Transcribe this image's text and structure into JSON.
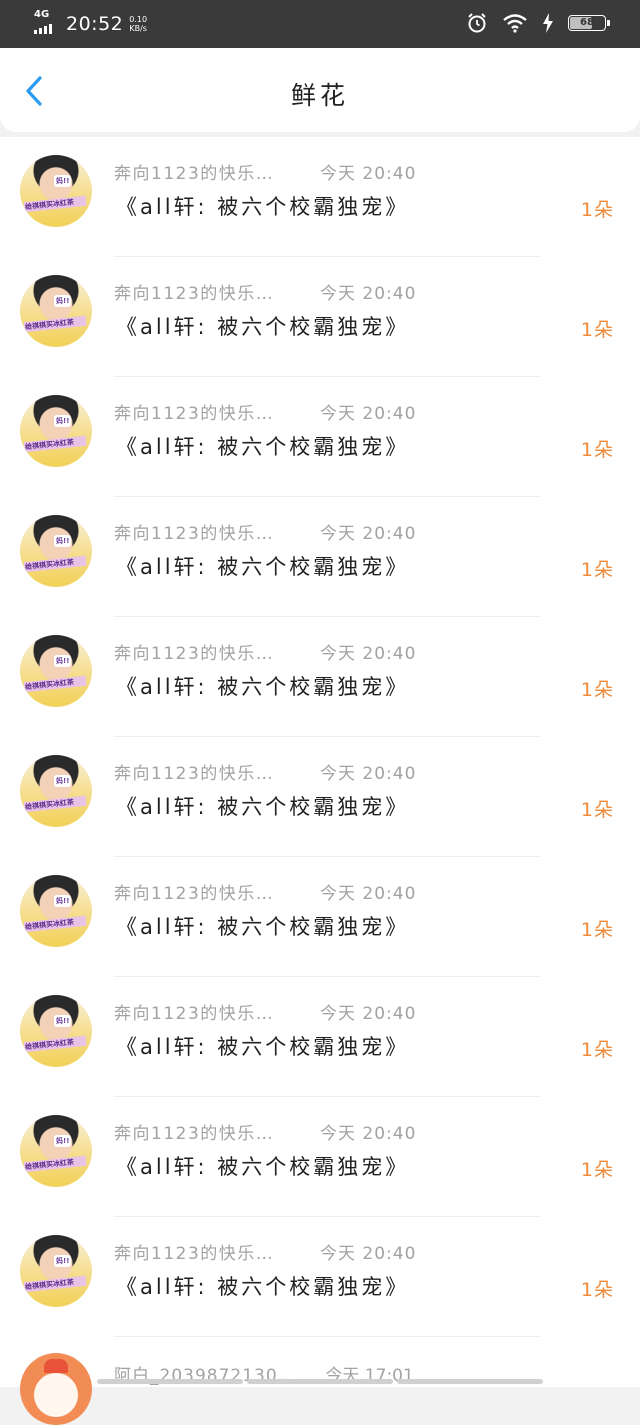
{
  "status_bar": {
    "network": "4G",
    "time": "20:52",
    "speed_value": "0.10",
    "speed_unit": "KB/s",
    "battery": "68",
    "battery_level": 0.68,
    "icons": [
      "alarm-icon",
      "wifi-icon",
      "charging-icon",
      "battery-icon"
    ]
  },
  "header": {
    "title": "鲜花",
    "back_icon": "chevron-left-icon",
    "accent": "#2a9bf0"
  },
  "items": [
    {
      "user": "奔向1123的快乐…",
      "time": "今天 20:40",
      "title": "《all轩: 被六个校霸独宠》",
      "count": "1朵"
    },
    {
      "user": "奔向1123的快乐…",
      "time": "今天 20:40",
      "title": "《all轩: 被六个校霸独宠》",
      "count": "1朵"
    },
    {
      "user": "奔向1123的快乐…",
      "time": "今天 20:40",
      "title": "《all轩: 被六个校霸独宠》",
      "count": "1朵"
    },
    {
      "user": "奔向1123的快乐…",
      "time": "今天 20:40",
      "title": "《all轩: 被六个校霸独宠》",
      "count": "1朵"
    },
    {
      "user": "奔向1123的快乐…",
      "time": "今天 20:40",
      "title": "《all轩: 被六个校霸独宠》",
      "count": "1朵"
    },
    {
      "user": "奔向1123的快乐…",
      "time": "今天 20:40",
      "title": "《all轩: 被六个校霸独宠》",
      "count": "1朵"
    },
    {
      "user": "奔向1123的快乐…",
      "time": "今天 20:40",
      "title": "《all轩: 被六个校霸独宠》",
      "count": "1朵"
    },
    {
      "user": "奔向1123的快乐…",
      "time": "今天 20:40",
      "title": "《all轩: 被六个校霸独宠》",
      "count": "1朵"
    },
    {
      "user": "奔向1123的快乐…",
      "time": "今天 20:40",
      "title": "《all轩: 被六个校霸独宠》",
      "count": "1朵"
    },
    {
      "user": "奔向1123的快乐…",
      "time": "今天 20:40",
      "title": "《all轩: 被六个校霸独宠》",
      "count": "1朵"
    }
  ],
  "avatar_caption": {
    "bubble": "妈!!",
    "banner": "给祺祺买冰红茶"
  },
  "partial_item": {
    "user": "阿白_2039872130…",
    "time": "今天 17:01"
  },
  "colors": {
    "count": "#f08a3a",
    "meta": "#a2a2a2",
    "title": "#222222"
  }
}
